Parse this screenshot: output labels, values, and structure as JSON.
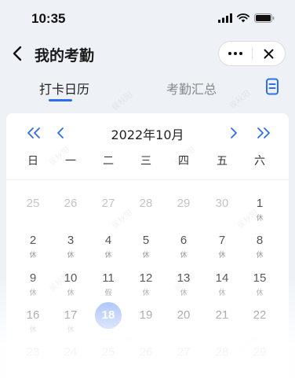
{
  "status_bar": {
    "time": "10:35"
  },
  "nav": {
    "title": "我的考勤"
  },
  "tabs": [
    {
      "label": "打卡日历",
      "active": true
    },
    {
      "label": "考勤汇总",
      "active": false
    }
  ],
  "calendar": {
    "month_title": "2022年10月",
    "weekdays": [
      "日",
      "一",
      "二",
      "三",
      "四",
      "五",
      "六"
    ],
    "days": [
      {
        "num": "25",
        "tag": "",
        "other": true
      },
      {
        "num": "26",
        "tag": "",
        "other": true
      },
      {
        "num": "27",
        "tag": "",
        "other": true
      },
      {
        "num": "28",
        "tag": "",
        "other": true
      },
      {
        "num": "29",
        "tag": "",
        "other": true
      },
      {
        "num": "30",
        "tag": "",
        "other": true
      },
      {
        "num": "1",
        "tag": "休",
        "other": false
      },
      {
        "num": "2",
        "tag": "休",
        "other": false
      },
      {
        "num": "3",
        "tag": "休",
        "other": false
      },
      {
        "num": "4",
        "tag": "休",
        "other": false
      },
      {
        "num": "5",
        "tag": "休",
        "other": false
      },
      {
        "num": "6",
        "tag": "休",
        "other": false
      },
      {
        "num": "7",
        "tag": "休",
        "other": false
      },
      {
        "num": "8",
        "tag": "休",
        "other": false
      },
      {
        "num": "9",
        "tag": "休",
        "other": false
      },
      {
        "num": "10",
        "tag": "休",
        "other": false
      },
      {
        "num": "11",
        "tag": "假",
        "other": false
      },
      {
        "num": "12",
        "tag": "休",
        "other": false
      },
      {
        "num": "13",
        "tag": "休",
        "other": false
      },
      {
        "num": "14",
        "tag": "休",
        "other": false
      },
      {
        "num": "15",
        "tag": "休",
        "other": false
      },
      {
        "num": "16",
        "tag": "休",
        "other": false
      },
      {
        "num": "17",
        "tag": "休",
        "other": false
      },
      {
        "num": "18",
        "tag": "",
        "other": false,
        "today": true
      },
      {
        "num": "19",
        "tag": "",
        "other": false
      },
      {
        "num": "20",
        "tag": "",
        "other": false
      },
      {
        "num": "21",
        "tag": "",
        "other": false
      },
      {
        "num": "22",
        "tag": "",
        "other": false
      },
      {
        "num": "23",
        "tag": "",
        "other": false
      },
      {
        "num": "24",
        "tag": "",
        "other": false
      },
      {
        "num": "25",
        "tag": "",
        "other": false
      },
      {
        "num": "26",
        "tag": "",
        "other": false
      },
      {
        "num": "27",
        "tag": "",
        "other": false
      },
      {
        "num": "28",
        "tag": "",
        "other": false
      },
      {
        "num": "29",
        "tag": "",
        "other": false
      }
    ]
  },
  "watermark": "侯秋阳",
  "colors": {
    "accent": "#2f6df0",
    "today_bg": "#87a9f7"
  }
}
